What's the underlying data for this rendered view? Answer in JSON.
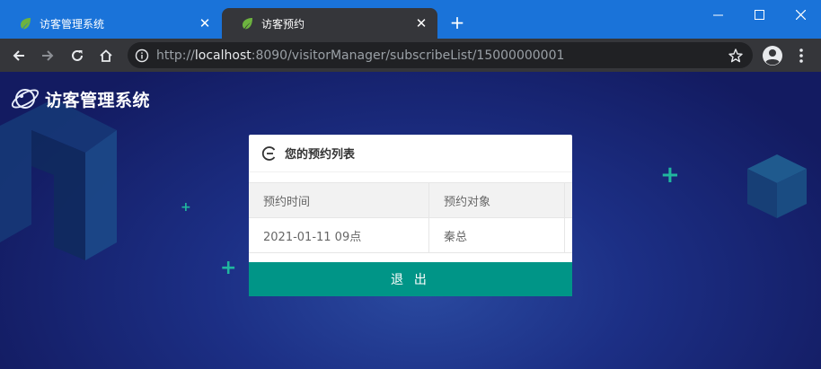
{
  "browser": {
    "tabs": [
      {
        "title": "访客管理系统",
        "active": false
      },
      {
        "title": "访客预约",
        "active": true
      }
    ],
    "new_tab": "+",
    "url_scheme": "http://",
    "url_host": "localhost",
    "url_rest": ":8090/visitorManager/subscribeList/15000000001"
  },
  "brand": {
    "name": "访客管理系统"
  },
  "card": {
    "title": "您的预约列表",
    "columns": [
      "预约时间",
      "预约对象"
    ],
    "rows": [
      {
        "time": "2021-01-11 09点",
        "target": "秦总"
      }
    ]
  },
  "actions": {
    "logout": "退 出"
  },
  "colors": {
    "accent": "#009587",
    "titlebar": "#1a73d9",
    "background": "#131b61"
  }
}
